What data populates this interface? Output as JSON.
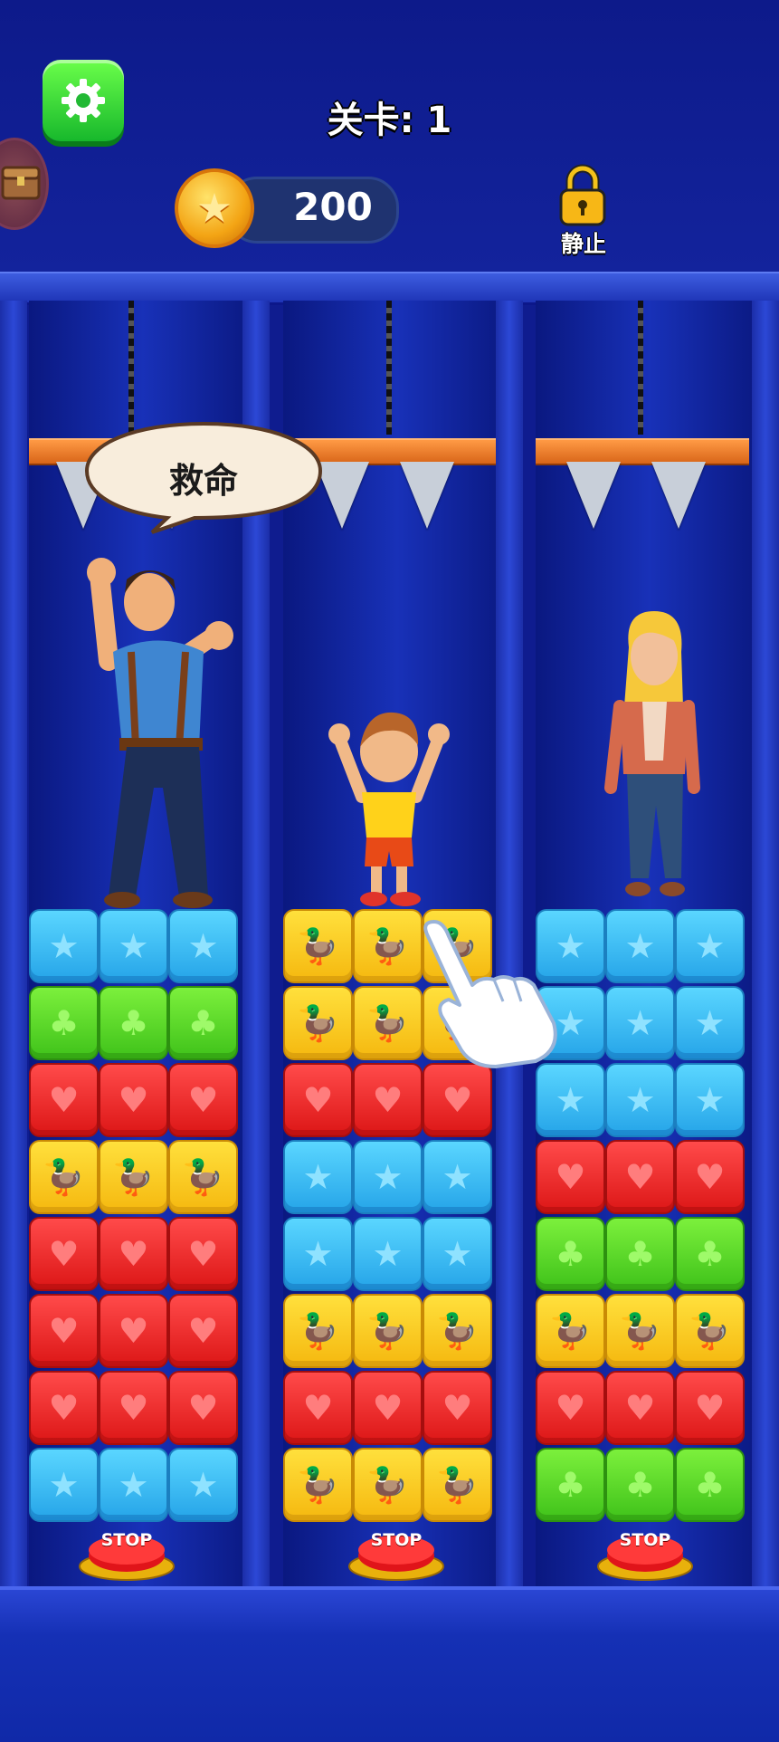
{
  "hud": {
    "level_title": "关卡: 1",
    "coins": "200",
    "lock_label": "静止",
    "settings_icon": "gear-icon",
    "coin_icon": "star-coin-icon",
    "lock_icon": "padlock-icon",
    "chest_icon": "treasure-chest-icon"
  },
  "speech_bubble": "救命",
  "columns": [
    {
      "character": "man",
      "rows": [
        "blue",
        "green",
        "red",
        "yellow",
        "red",
        "red",
        "red",
        "blue"
      ],
      "stop_label": "STOP"
    },
    {
      "character": "boy",
      "rows": [
        "yellow",
        "yellow",
        "red",
        "blue",
        "blue",
        "yellow",
        "red",
        "yellow"
      ],
      "stop_label": "STOP"
    },
    {
      "character": "woman",
      "rows": [
        "blue",
        "blue",
        "blue",
        "red",
        "green",
        "yellow",
        "red",
        "green"
      ],
      "stop_label": "STOP"
    }
  ],
  "block_symbols": {
    "blue": "★",
    "green": "♣",
    "red": "♥",
    "yellow": "🦆"
  },
  "colors": {
    "background": "#0f1c8f",
    "blue_block": "#25a4e8",
    "green_block": "#3fc21a",
    "red_block": "#dc1616",
    "yellow_block": "#f5b80f",
    "settings_button": "#17b82c",
    "plank": "#d86518"
  },
  "tutorial_hand_icon": "pointing-hand-icon"
}
